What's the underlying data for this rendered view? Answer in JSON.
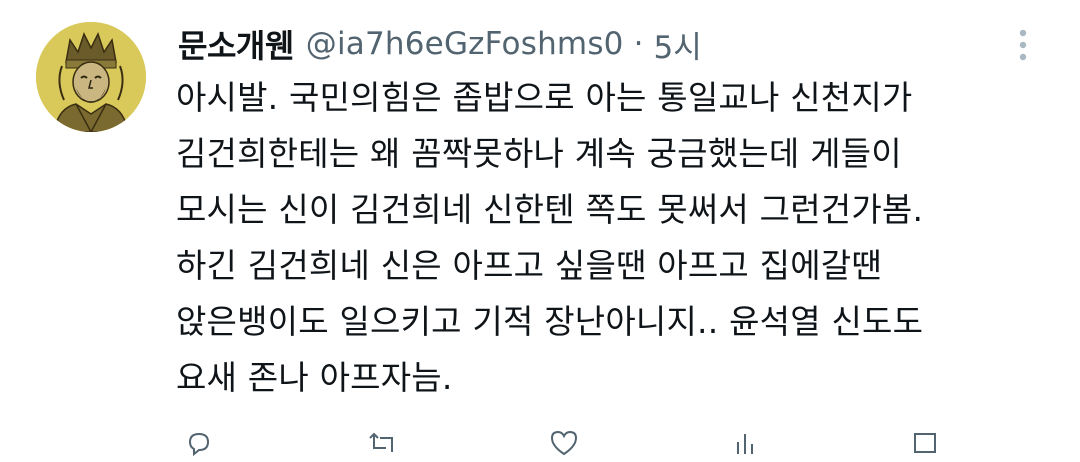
{
  "tweet": {
    "display_name": "문소개웬",
    "handle": "@ia7h6eGzFoshms0",
    "separator": "·",
    "time": "5시",
    "lines": [
      "아시발. 국민의힘은 좁밥으로 아는 통일교나 신천지가",
      "김건희한테는 왜 꼼짝못하나 계속 궁금했는데 게들이",
      "모시는 신이 김건희네 신한텐 쪽도 못써서 그런건가봄.",
      "하긴 김건희네 신은 아프고 싶을땐 아프고 집에갈땐",
      "앉은뱅이도 일으키고 기적 장난아니지.. 윤석열 신도도",
      "요새 존나 아프자늠."
    ]
  },
  "icons": {
    "avatar": "avatar-portrait",
    "more": "more-vertical-icon",
    "actions": [
      "reply-icon",
      "retweet-icon",
      "like-icon",
      "views-icon",
      "share-icon"
    ]
  },
  "colors": {
    "text": "#0f1419",
    "secondary": "#536471",
    "avatar_bg": "#d8c95a",
    "more_dots": "#aab8c2"
  }
}
